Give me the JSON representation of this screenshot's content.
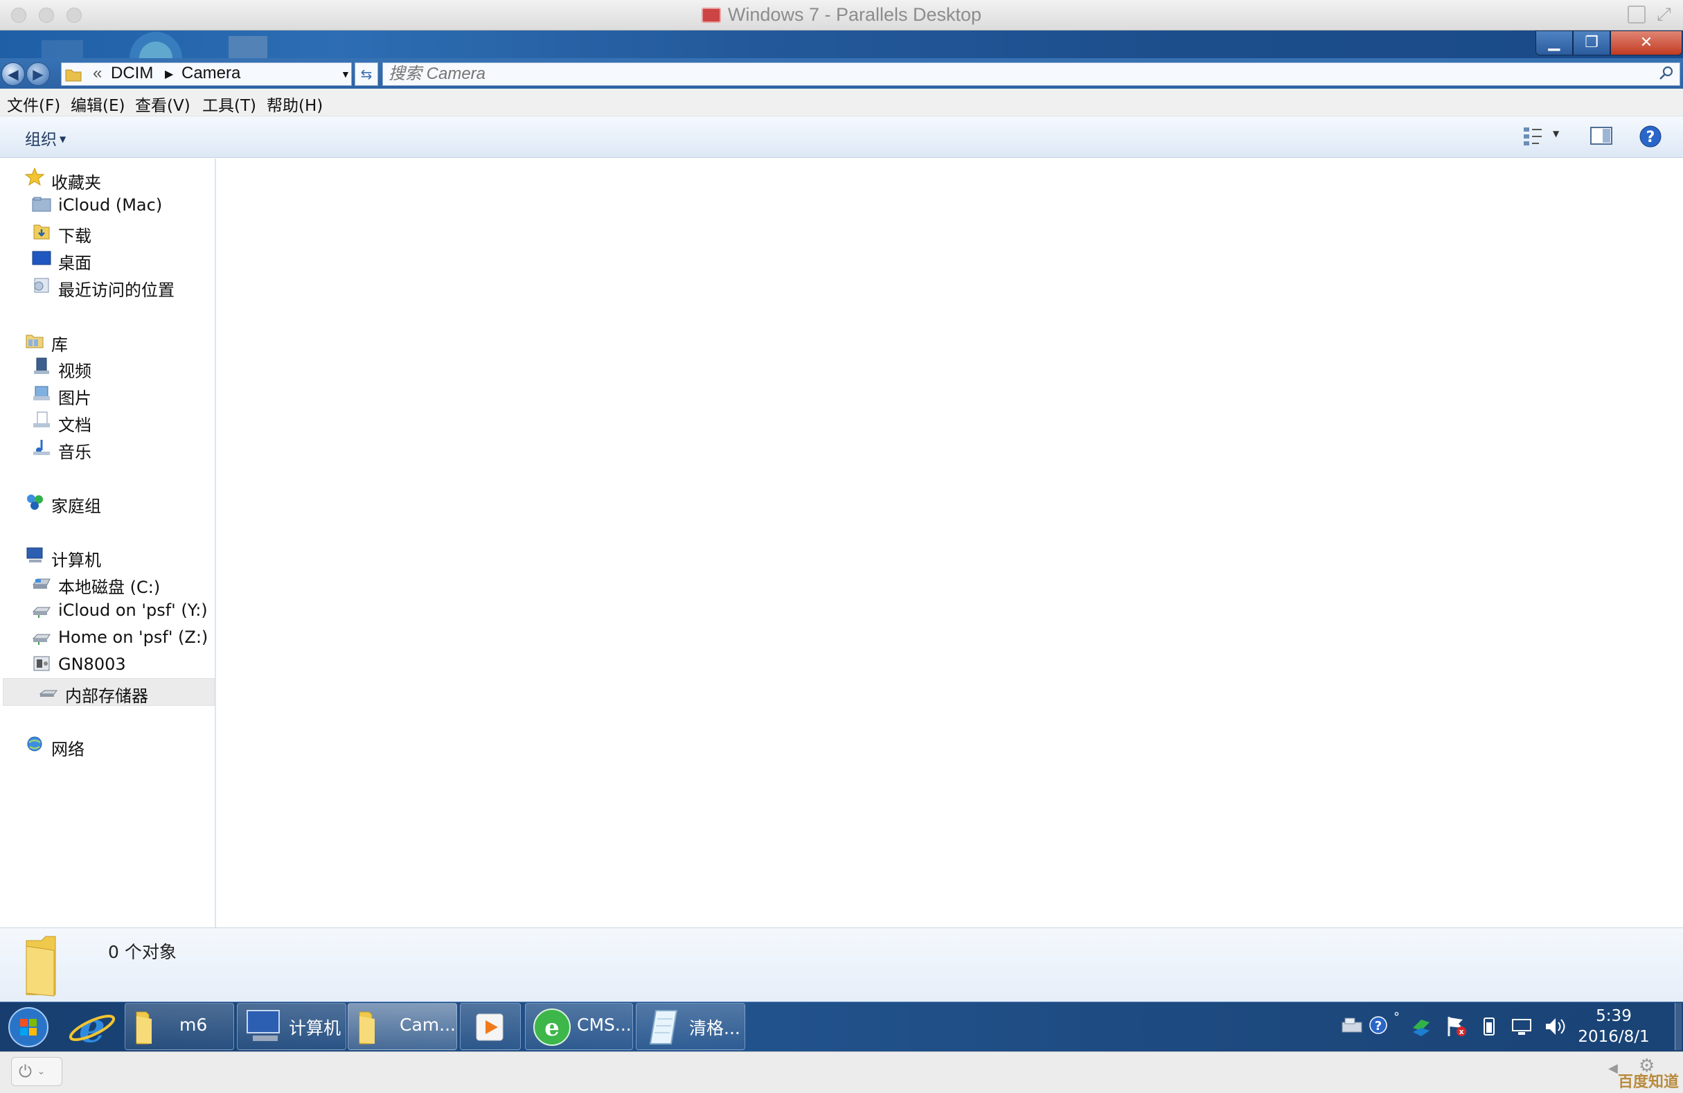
{
  "mac_window": {
    "title": "Windows 7 - Parallels Desktop"
  },
  "address_bar": {
    "prefix": "«",
    "crumbs": [
      "DCIM",
      "Camera"
    ],
    "search_placeholder": "搜索 Camera"
  },
  "menu": [
    "文件(F)",
    "编辑(E)",
    "查看(V)",
    "工具(T)",
    "帮助(H)"
  ],
  "toolbar": {
    "organize_label": "组织"
  },
  "nav": {
    "favorites": {
      "label": "收藏夹",
      "items": [
        "iCloud (Mac)",
        "下载",
        "桌面",
        "最近访问的位置"
      ]
    },
    "libraries": {
      "label": "库",
      "items": [
        "视频",
        "图片",
        "文档",
        "音乐"
      ]
    },
    "homegroup": {
      "label": "家庭组"
    },
    "computer": {
      "label": "计算机",
      "items": [
        "本地磁盘 (C:)",
        "iCloud on 'psf' (Y:)",
        "Home on 'psf' (Z:)",
        "GN8003"
      ]
    },
    "selected_item": "内部存储器",
    "network": {
      "label": "网络"
    }
  },
  "details": {
    "object_count": "0 个对象"
  },
  "taskbar": {
    "buttons": [
      "m6",
      "计算机",
      "Cam...",
      "CMS...",
      "清格..."
    ],
    "clock": {
      "time": "5:39",
      "date": "2016/8/1"
    }
  },
  "watermark": "百度知道",
  "colors": {
    "taskbar": "#1d4a80",
    "title_strip": "#23599a",
    "close_button": "#c23b22",
    "selected_nav": "#ebebeb"
  }
}
